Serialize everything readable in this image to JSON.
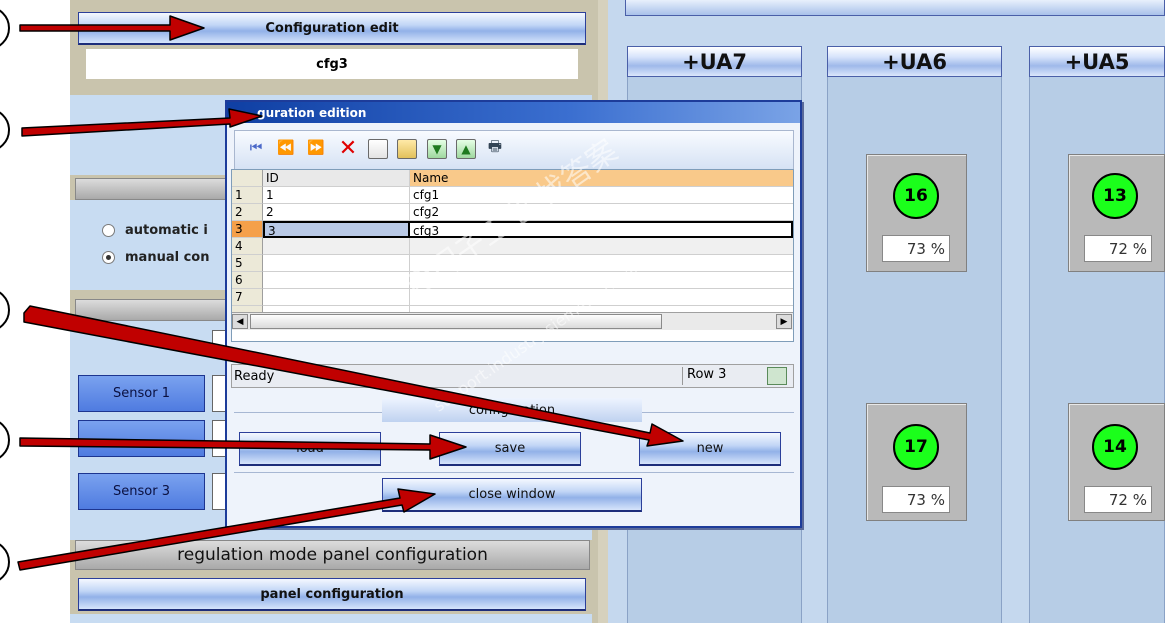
{
  "left_panel": {
    "config_edit_btn": "Configuration edit",
    "current_config": "cfg3",
    "radio_auto": "automatic i",
    "radio_manual": "manual con",
    "sensors": [
      "Sensor 1",
      "Sensor 3"
    ],
    "regulation_header": "regulation mode panel configuration",
    "panel_config_btn": "panel configuration"
  },
  "ua_columns": [
    {
      "title": "+UA7"
    },
    {
      "title": "+UA6",
      "tiles": [
        {
          "num": "16",
          "pct": "73 %"
        },
        {
          "num": "17",
          "pct": "73 %"
        }
      ]
    },
    {
      "title": "+UA5",
      "tiles": [
        {
          "num": "13",
          "pct": "72 %"
        },
        {
          "num": "14",
          "pct": "72 %"
        }
      ]
    }
  ],
  "dialog": {
    "title": "guration edition",
    "columns": [
      "ID",
      "Name"
    ],
    "rows": [
      {
        "n": "1",
        "id": "1",
        "name": "cfg1"
      },
      {
        "n": "2",
        "id": "2",
        "name": "cfg2"
      },
      {
        "n": "3",
        "id": "3",
        "name": "cfg3"
      },
      {
        "n": "4",
        "id": "",
        "name": ""
      },
      {
        "n": "5",
        "id": "",
        "name": ""
      },
      {
        "n": "6",
        "id": "",
        "name": ""
      },
      {
        "n": "7",
        "id": "",
        "name": ""
      }
    ],
    "status_left": "Ready",
    "status_row": "Row 3",
    "group_label": "configuration",
    "load_btn": "load",
    "save_btn": "save",
    "new_btn": "new",
    "close_btn": "close window"
  },
  "watermark": {
    "cn": "西门子工业 找答案",
    "url": "support.industry.siemens.com/cs"
  },
  "colors": {
    "arrow": "#c00000",
    "indicator_green": "#1bff1b",
    "dialog_title": "#0f3fa3",
    "header_orange": "#f9c98a"
  }
}
